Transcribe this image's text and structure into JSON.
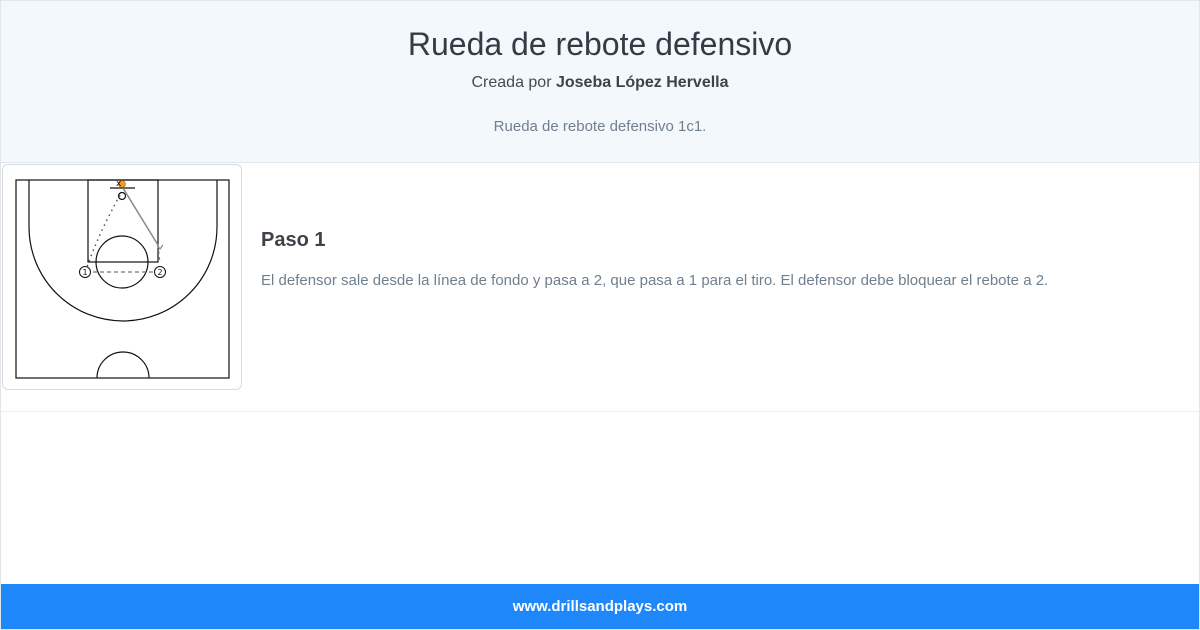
{
  "header": {
    "title": "Rueda de rebote defensivo",
    "created_by_prefix": "Creada por ",
    "author": "Joseba López Hervella",
    "description": "Rueda de rebote defensivo 1c1."
  },
  "steps": [
    {
      "title": "Paso 1",
      "text": "El defensor sale desde la línea de fondo y pasa a 2, que pasa a 1 para el tiro. El defensor debe bloquear el rebote a 2.",
      "diagram": {
        "players": [
          {
            "label": "1"
          },
          {
            "label": "2"
          }
        ],
        "defender_marker": "x"
      }
    }
  ],
  "footer": {
    "link": "www.drillsandplays.com"
  },
  "colors": {
    "header_bg": "#f3f8fd",
    "footer_bg": "#1e88fb",
    "ball": "#f0a020"
  }
}
